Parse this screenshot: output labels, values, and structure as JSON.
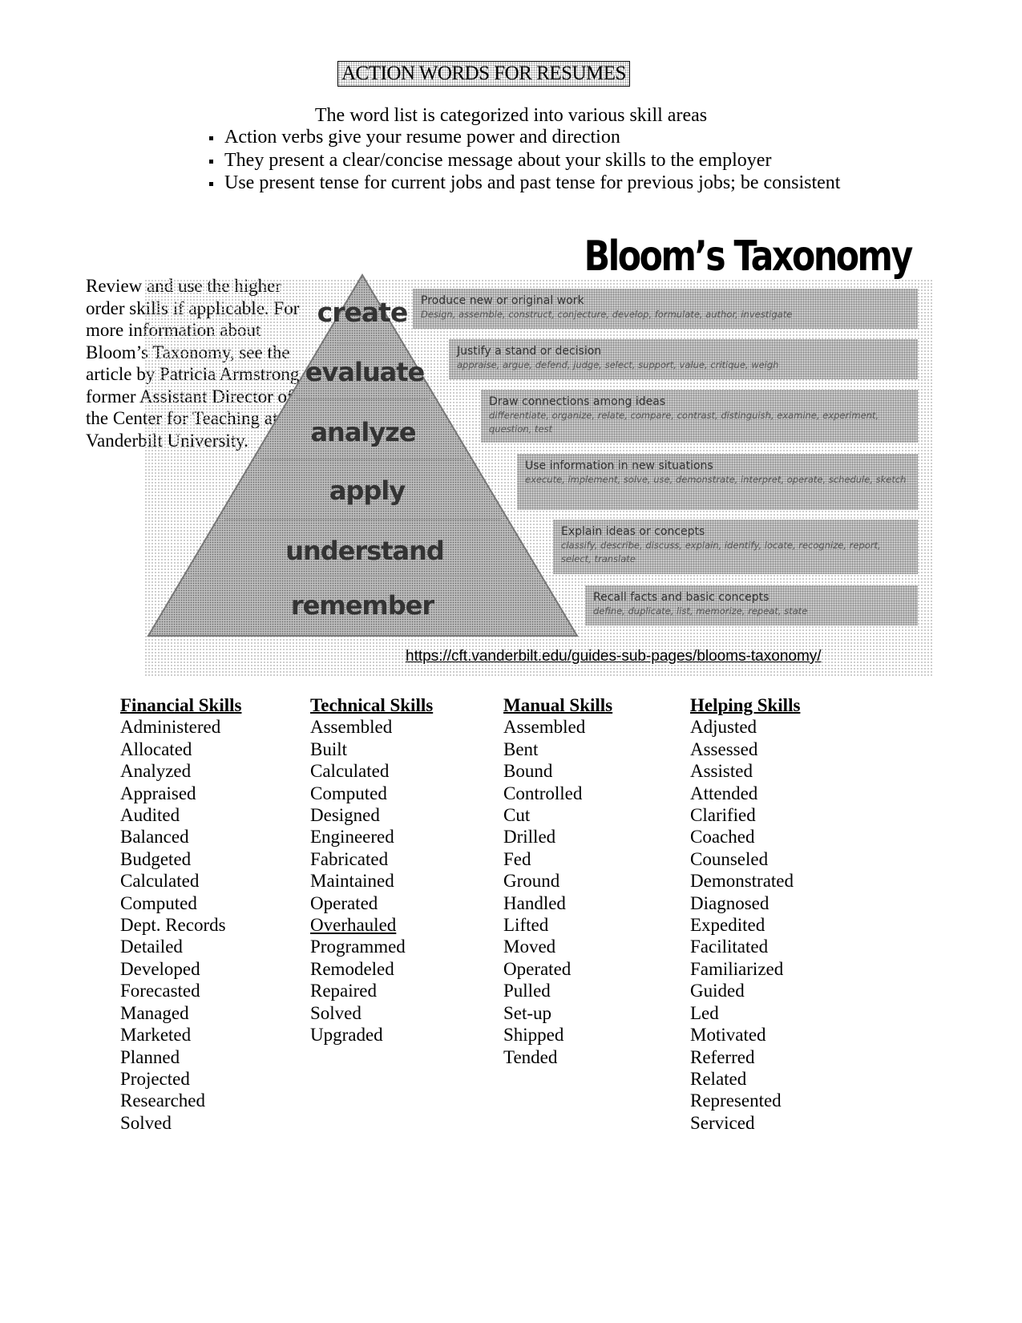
{
  "header": {
    "title": "ACTION WORDS FOR RESUMES",
    "intro": "The word list is categorized into various skill areas",
    "bullets": [
      "Action verbs give your resume power and direction",
      "They present a clear/concise message about your skills to the employer",
      "Use present tense for current jobs and past tense for previous jobs; be consistent"
    ]
  },
  "side_note": "Review and use the higher order skills if applicable. For more information about Bloom’s Taxonomy, see the article by Patricia Armstrong, former Assistant Director of the Center for Teaching at Vanderbilt University.",
  "bloom": {
    "title": "Bloom’s Taxonomy",
    "levels": [
      {
        "label": "create",
        "heading": "Produce new or original work",
        "verbs": "Design, assemble, construct, conjecture, develop, formulate, author, investigate"
      },
      {
        "label": "evaluate",
        "heading": "Justify a stand or decision",
        "verbs": "appraise, argue, defend, judge, select, support, value, critique, weigh"
      },
      {
        "label": "analyze",
        "heading": "Draw connections among ideas",
        "verbs": "differentiate, organize, relate, compare, contrast, distinguish, examine, experiment, question, test"
      },
      {
        "label": "apply",
        "heading": "Use information in new situations",
        "verbs": "execute, implement, solve, use, demonstrate, interpret, operate, schedule, sketch"
      },
      {
        "label": "understand",
        "heading": "Explain ideas or concepts",
        "verbs": "classify, describe, discuss, explain, identify, locate, recognize, report, select, translate"
      },
      {
        "label": "remember",
        "heading": "Recall facts and basic concepts",
        "verbs": "define, duplicate, list, memorize, repeat, state"
      }
    ],
    "url": "https://cft.vanderbilt.edu/guides-sub-pages/blooms-taxonomy/"
  },
  "columns": [
    {
      "header": "Financial Skills",
      "words": [
        "Administered",
        "Allocated",
        "Analyzed",
        "Appraised",
        "Audited",
        "Balanced",
        "Budgeted",
        "Calculated",
        "Computed",
        "Dept. Records",
        "Detailed",
        "Developed",
        "Forecasted",
        "Managed",
        "Marketed",
        "Planned",
        "Projected",
        "Researched",
        "Solved"
      ]
    },
    {
      "header": "Technical Skills",
      "words": [
        "Assembled",
        "Built",
        "Calculated",
        "Computed",
        "Designed",
        "Engineered",
        "Fabricated",
        "Maintained",
        "Operated",
        "Overhauled",
        "Programmed",
        "Remodeled",
        "Repaired",
        "Solved",
        "Upgraded"
      ]
    },
    {
      "header": "Manual Skills",
      "words": [
        "Assembled",
        "Bent",
        "Bound",
        "Controlled",
        "Cut",
        "Drilled",
        "Fed",
        "Ground",
        "Handled",
        "Lifted",
        "Moved",
        "Operated",
        "Pulled",
        "Set-up",
        "Shipped",
        "Tended"
      ]
    },
    {
      "header": "Helping Skills",
      "words": [
        "Adjusted",
        "Assessed",
        "Assisted",
        "Attended",
        "Clarified",
        "Coached",
        "Counseled",
        "Demonstrated",
        "Diagnosed",
        "Expedited",
        "Facilitated",
        "Familiarized",
        "Guided",
        "Led",
        "Motivated",
        "Referred",
        "Related",
        "Represented",
        "Serviced"
      ]
    }
  ]
}
